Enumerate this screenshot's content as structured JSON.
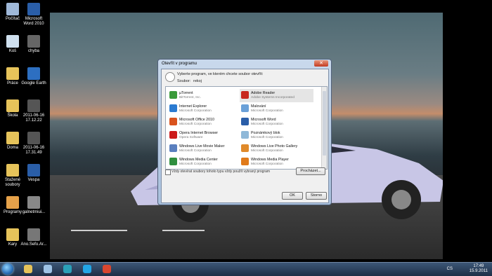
{
  "desktop": {
    "icons": [
      {
        "label": "Počítač",
        "icon": "computer-icon",
        "color": "#9fb8d8"
      },
      {
        "label": "Microsoft Word 2010",
        "icon": "word-icon",
        "color": "#2a5ea8"
      },
      {
        "label": "Koš",
        "icon": "recycle-bin-icon",
        "color": "#cfe0ef"
      },
      {
        "label": "chyba",
        "icon": "image-icon",
        "color": "#666666"
      },
      {
        "label": "Práce",
        "icon": "folder-icon",
        "color": "#e6c35a"
      },
      {
        "label": "Google Earth",
        "icon": "google-earth-icon",
        "color": "#2d6fc1"
      },
      {
        "label": "Škola",
        "icon": "folder-icon",
        "color": "#e6c35a"
      },
      {
        "label": "2011-06-16 17.12.22",
        "icon": "image-icon",
        "color": "#555555"
      },
      {
        "label": "Doma",
        "icon": "folder-icon",
        "color": "#e6c35a"
      },
      {
        "label": "2011-06-16 17.31.49",
        "icon": "image-icon",
        "color": "#555555"
      },
      {
        "label": "Stažené soubory",
        "icon": "folder-icon",
        "color": "#e6c35a"
      },
      {
        "label": "Vespa",
        "icon": "word-doc-icon",
        "color": "#2a5ea8"
      },
      {
        "label": "Programy",
        "icon": "folder-icon",
        "color": "#e6a24a"
      },
      {
        "label": "galnetmiui...",
        "icon": "file-icon",
        "color": "#888888"
      },
      {
        "label": "Kary",
        "icon": "folder-icon",
        "color": "#e6c35a"
      },
      {
        "label": "Ano.Sefo.Ar...",
        "icon": "file-icon",
        "color": "#777777"
      }
    ]
  },
  "dialog": {
    "title": "Otevřít v programu",
    "close_label": "✕",
    "header_text": "Vyberte program, ve kterém chcete soubor otevřít:",
    "file_label": "Soubor:",
    "file_value": "rekoj",
    "programs": [
      {
        "name": "µTorrent",
        "company": "BitTorrent, Inc.",
        "icon": "utorrent-icon",
        "color": "#3a9a3a"
      },
      {
        "name": "Adobe Reader",
        "company": "Adobe Systems Incorporated",
        "icon": "adobe-reader-icon",
        "color": "#c8281e"
      },
      {
        "name": "Internet Explorer",
        "company": "Microsoft Corporation",
        "icon": "internet-explorer-icon",
        "color": "#2b7bd1"
      },
      {
        "name": "Malování",
        "company": "Microsoft Corporation",
        "icon": "paint-icon",
        "color": "#6aa0d8"
      },
      {
        "name": "Microsoft Office 2010",
        "company": "Microsoft Corporation",
        "icon": "office-icon",
        "color": "#d9531e"
      },
      {
        "name": "Microsoft Word",
        "company": "Microsoft Corporation",
        "icon": "word-icon",
        "color": "#2a5ea8"
      },
      {
        "name": "Opera Internet Browser",
        "company": "Opera Software",
        "icon": "opera-icon",
        "color": "#cc1b1b"
      },
      {
        "name": "Poznámkový blok",
        "company": "Microsoft Corporation",
        "icon": "notepad-icon",
        "color": "#8fb8d8"
      },
      {
        "name": "Windows Live Movie Maker",
        "company": "Microsoft Corporation",
        "icon": "movie-maker-icon",
        "color": "#5a7fbf"
      },
      {
        "name": "Windows Live Photo Gallery",
        "company": "Microsoft Corporation",
        "icon": "photo-gallery-icon",
        "color": "#e08a2a"
      },
      {
        "name": "Windows Media Center",
        "company": "Microsoft Corporation",
        "icon": "media-center-icon",
        "color": "#2f8f3f"
      },
      {
        "name": "Windows Media Player",
        "company": "Microsoft Corporation",
        "icon": "media-player-icon",
        "color": "#e07a1a"
      }
    ],
    "checkbox_label": "Vždy otevírat soubory tohoto typu vždy použít vybraný program",
    "browse_label": "Procházet...",
    "ok_label": "OK",
    "cancel_label": "Storno"
  },
  "taskbar": {
    "language": "CS",
    "time": "17:49",
    "date": "15.9.2011",
    "pinned": [
      {
        "icon": "explorer-icon",
        "color": "#e6c35a"
      },
      {
        "icon": "network-icon",
        "color": "#9ec3e6"
      },
      {
        "icon": "kis-icon",
        "color": "#2aa0b8"
      },
      {
        "icon": "skype-icon",
        "color": "#22a6e6"
      },
      {
        "icon": "chrome-icon",
        "color": "#d9462f"
      }
    ]
  }
}
